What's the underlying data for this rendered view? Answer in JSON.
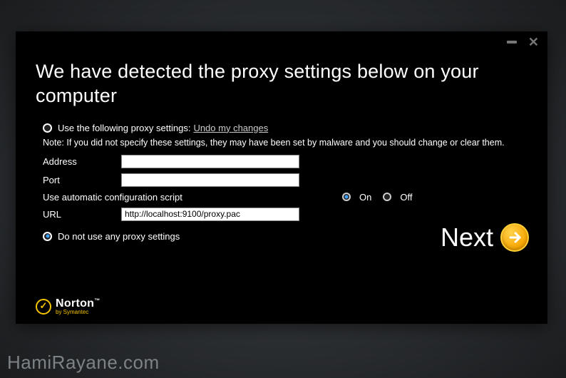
{
  "window": {
    "title": "We have detected the proxy settings below on your computer"
  },
  "proxy": {
    "use_label": "Use the following proxy settings:",
    "undo_link": "Undo my changes",
    "note": "Note: If you did not specify these settings, they may have been set by malware and you should change or clear them.",
    "address_label": "Address",
    "address_value": "",
    "port_label": "Port",
    "port_value": "",
    "script_label": "Use automatic configuration script",
    "on_label": "On",
    "off_label": "Off",
    "url_label": "URL",
    "url_value": "http://localhost:9100/proxy.pac",
    "donot_label": "Do not use any proxy settings",
    "script_mode": "on",
    "top_choice": "donot"
  },
  "actions": {
    "next_label": "Next"
  },
  "brand": {
    "name": "Norton",
    "sub": "by Symantec"
  },
  "watermark": "HamiRayane.com"
}
